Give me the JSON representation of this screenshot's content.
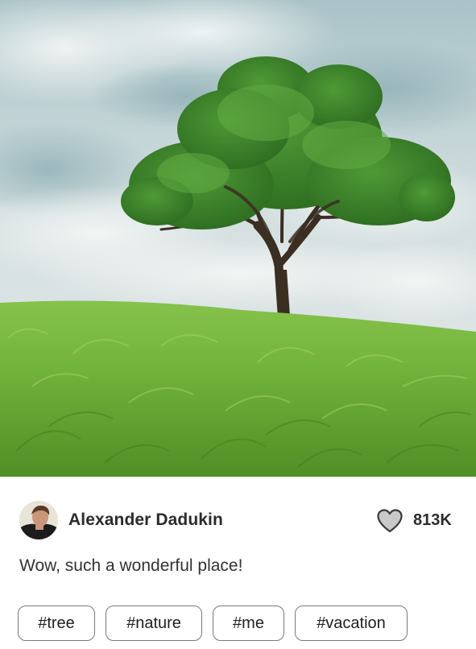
{
  "post": {
    "image_alt": "Lone tree on a green grassy hill under a cloudy sky",
    "author": {
      "name": "Alexander Dadukin"
    },
    "likes": {
      "count": "813K",
      "icon": "heart-icon"
    },
    "caption": "Wow, such a wonderful place!",
    "tags": [
      "#tree",
      "#nature",
      "#me",
      "#vacation"
    ]
  },
  "colors": {
    "text": "#2b2b2b",
    "tag_border": "#7a7a7a",
    "heart_fill": "#c9c9c9",
    "heart_stroke": "#3a3a3a",
    "grass": "#6fb33c",
    "sky": "#cfdcdf"
  }
}
